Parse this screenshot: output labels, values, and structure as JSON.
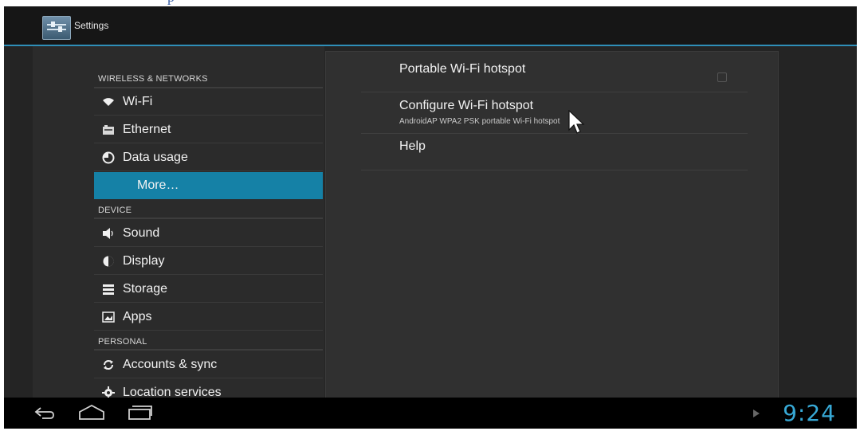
{
  "top_crop_text": "p",
  "actionbar": {
    "title": "Settings",
    "icon": "settings-icon"
  },
  "sections": {
    "wireless": "WIRELESS & NETWORKS",
    "device": "DEVICE",
    "personal": "PERSONAL"
  },
  "sidebar": {
    "items": [
      {
        "label": "Wi-Fi",
        "icon": "wifi-icon"
      },
      {
        "label": "Ethernet",
        "icon": "ethernet-icon"
      },
      {
        "label": "Data usage",
        "icon": "data-usage-icon"
      },
      {
        "label": "More…",
        "icon": ""
      },
      {
        "label": "Sound",
        "icon": "speaker-icon"
      },
      {
        "label": "Display",
        "icon": "display-icon"
      },
      {
        "label": "Storage",
        "icon": "storage-icon"
      },
      {
        "label": "Apps",
        "icon": "apps-icon"
      },
      {
        "label": "Accounts & sync",
        "icon": "sync-icon"
      },
      {
        "label": "Location services",
        "icon": "location-icon"
      }
    ]
  },
  "content": {
    "prefs": [
      {
        "title": "Portable Wi-Fi hotspot",
        "summary": ""
      },
      {
        "title": "Configure Wi-Fi hotspot",
        "summary": "AndroidAP WPA2 PSK portable Wi-Fi hotspot"
      },
      {
        "title": "Help",
        "summary": ""
      }
    ]
  },
  "navbar": {
    "time": "9:24"
  },
  "colors": {
    "accent": "#1581a6",
    "clock": "#37a9d6"
  }
}
